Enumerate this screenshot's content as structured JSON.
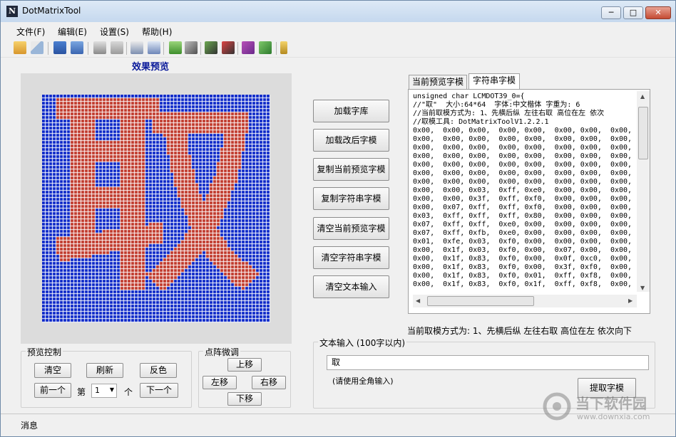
{
  "window": {
    "title": "DotMatrixTool",
    "minimize": "─",
    "maximize": "□",
    "close": "✕",
    "app_icon": "N"
  },
  "menu": [
    "文件(F)",
    "编辑(E)",
    "设置(S)",
    "帮助(H)"
  ],
  "toolbar_icons": [
    "open-folder-icon",
    "eraser-icon",
    "save-icon",
    "save-all-icon",
    "floppy-icon",
    "copy-icon",
    "print-icon",
    "print-preview-icon",
    "export-icon",
    "tools-icon",
    "settings-icon",
    "cut-icon",
    "book-icon",
    "package-icon",
    "info-icon"
  ],
  "preview": {
    "title": "效果预览",
    "character": "取",
    "grid_size": 64,
    "colors": {
      "background": "#0b27c8",
      "foreground": "#c0392b",
      "gridline": "#ffffff"
    }
  },
  "preview_control": {
    "label": "预览控制",
    "clear": "清空",
    "refresh": "刷新",
    "invert": "反色",
    "prev": "前一个",
    "page_prefix": "第",
    "page_value": "1",
    "page_suffix": "个",
    "next": "下一个"
  },
  "fine_tune": {
    "label": "点阵微调",
    "up": "上移",
    "left": "左移",
    "right": "右移",
    "down": "下移"
  },
  "side_buttons": [
    "加载字库",
    "加载改后字模",
    "复制当前预览字模",
    "复制字符串字模",
    "清空当前预览字模",
    "清空字符串字模",
    "清空文本输入"
  ],
  "tabs": [
    {
      "label": "当前预览字模",
      "active": false
    },
    {
      "label": "字符串字模",
      "active": true
    }
  ],
  "code_lines": [
    "unsigned char LCMDOT39_0={",
    "//\"取\"  大小:64*64  字体:中文楷体 字重为: 6",
    "//当前取模方式为: 1、先横后纵 左往右取 高位在左 依次",
    "//取模工具: DotMatrixToolV1.2.2.1",
    "0x00,  0x00, 0x00,  0x00, 0x00,  0x00, 0x00,  0x00,",
    "0x00,  0x00, 0x00,  0x00, 0x00,  0x00, 0x00,  0x00,",
    "0x00,  0x00, 0x00,  0x00, 0x00,  0x00, 0x00,  0x00,",
    "0x00,  0x00, 0x00,  0x00, 0x00,  0x00, 0x00,  0x00,",
    "0x00,  0x00, 0x00,  0x00, 0x00,  0x00, 0x00,  0x00,",
    "0x00,  0x00, 0x00,  0x00, 0x00,  0x00, 0x00,  0x00,",
    "0x00,  0x00, 0x00,  0x00, 0x00,  0x00, 0x00,  0x00,",
    "0x00,  0x00, 0x03,  0xff, 0xe0,  0x00, 0x00,  0x00,",
    "0x00,  0x00, 0x3f,  0xff, 0xf0,  0x00, 0x00,  0x00,",
    "0x00,  0x07, 0xff,  0xff, 0xf0,  0x00, 0x00,  0x00,",
    "0x03,  0xff, 0xff,  0xff, 0x80,  0x00, 0x00,  0x00,",
    "0x07,  0xff, 0xff,  0xe0, 0x00,  0x00, 0x00,  0x00,",
    "0x07,  0xff, 0xfb,  0xe0, 0x00,  0x00, 0x00,  0x00,",
    "0x01,  0xfe, 0x03,  0xf0, 0x00,  0x00, 0x00,  0x00,",
    "0x00,  0x1f, 0x03,  0xf0, 0x00,  0x07, 0x00,  0x00,",
    "0x00,  0x1f, 0x83,  0xf0, 0x00,  0x0f, 0xc0,  0x00,",
    "0x00,  0x1f, 0x83,  0xf0, 0x00,  0x3f, 0xf0,  0x00,",
    "0x00,  0x1f, 0x83,  0xf0, 0x01,  0xff, 0xf8,  0x00,",
    "0x00,  0x1f, 0x83,  0xf0, 0x1f,  0xff, 0xf8,  0x00,"
  ],
  "current_mode": "当前取模方式为: 1、先横后纵 左往右取 高位在左 依次向下",
  "text_input": {
    "label": "文本输入 (100字以内)",
    "value": "取",
    "hint": "(请使用全角输入)",
    "extract_button": "提取字模"
  },
  "statusbar": {
    "message": "消息"
  },
  "watermark": {
    "text": "当下软件园",
    "url": "www.downxia.com"
  }
}
